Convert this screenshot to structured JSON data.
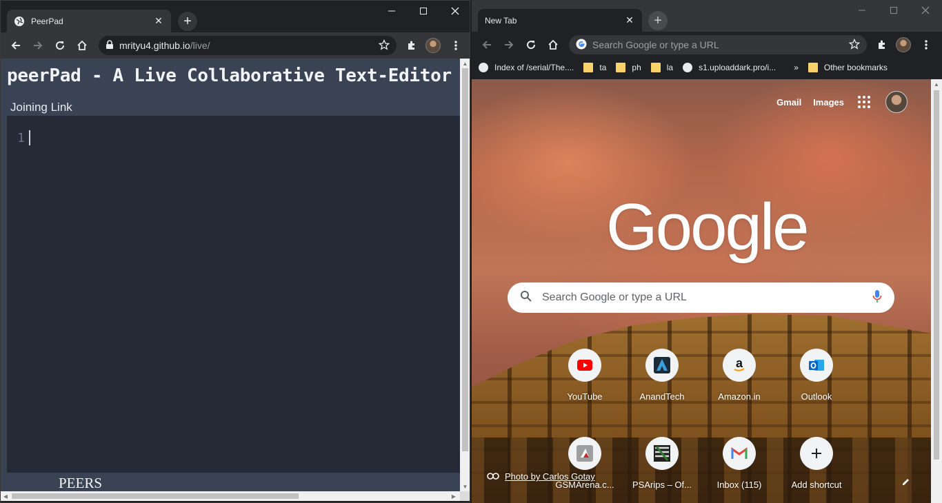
{
  "left": {
    "tab_title": "PeerPad",
    "url_host": "mrityu4.github.io",
    "url_path": "/live/",
    "page": {
      "title": "peerPad - A Live Collaborative Text-Editor",
      "joining_link": "Joining Link",
      "line_number": "1",
      "peers": "PEERS"
    }
  },
  "right": {
    "tab_title": "New Tab",
    "omnibox_placeholder": "Search Google or type a URL",
    "bookmarks": [
      {
        "label": "Index of /serial/The....",
        "icon": "globe-icon"
      },
      {
        "label": "ta",
        "icon": "folder-icon"
      },
      {
        "label": "ph",
        "icon": "folder-icon"
      },
      {
        "label": "la",
        "icon": "folder-icon"
      },
      {
        "label": "s1.uploaddark.pro/i...",
        "icon": "globe-icon"
      }
    ],
    "overflow": "»",
    "other_bookmarks": "Other bookmarks",
    "ntp": {
      "gmail": "Gmail",
      "images": "Images",
      "logo": "Google",
      "search_placeholder": "Search Google or type a URL",
      "shortcuts": [
        {
          "label": "YouTube",
          "icon": "youtube-icon"
        },
        {
          "label": "AnandTech",
          "icon": "anandtech-icon"
        },
        {
          "label": "Amazon.in",
          "icon": "amazon-icon"
        },
        {
          "label": "Outlook",
          "icon": "outlook-icon"
        },
        {
          "label": "GSMArena.c...",
          "icon": "gsmarena-icon"
        },
        {
          "label": "PSArips – Of...",
          "icon": "psarips-icon"
        },
        {
          "label": "Inbox (115)",
          "icon": "gmail-icon"
        },
        {
          "label": "Add shortcut",
          "icon": "plus-icon"
        }
      ],
      "photo_credit": "Photo by Carlos Gotay"
    }
  },
  "colors": {
    "chrome_dark": "#202124",
    "chrome_toolbar": "#35363a",
    "peerpad_header": "#3a4354",
    "peerpad_editor": "#262a36",
    "youtube_red": "#ff0000",
    "outlook_blue": "#0a64c8"
  }
}
